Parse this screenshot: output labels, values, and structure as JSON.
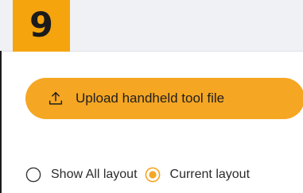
{
  "step": {
    "number": "9",
    "badge_color": "#f5a40e"
  },
  "upload": {
    "label": "Upload handheld tool file",
    "icon": "upload-icon",
    "color": "#f5a623"
  },
  "layout_options": [
    {
      "label": "Show All layout",
      "selected": false
    },
    {
      "label": "Current layout",
      "selected": true
    }
  ],
  "colors": {
    "accent": "#f5a623",
    "top_band": "#f0f1f5"
  }
}
